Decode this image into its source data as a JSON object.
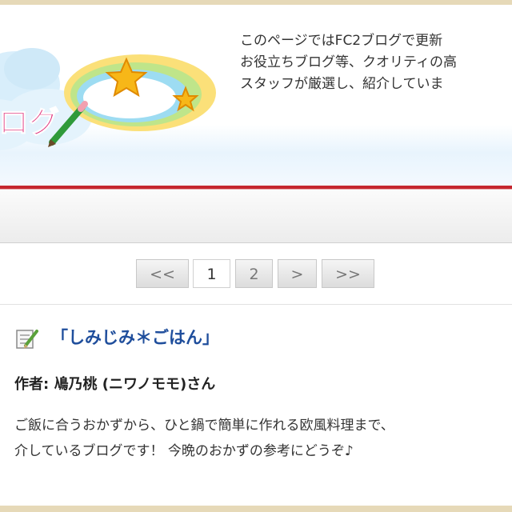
{
  "header": {
    "logo_fragment": "ログ",
    "intro_lines": [
      "このページではFC2ブログで更新",
      "お役立ちブログ等、クオリティの高",
      "スタッフが厳選し、紹介していま"
    ]
  },
  "pager": {
    "items": [
      {
        "label": "<<",
        "current": false
      },
      {
        "label": "1",
        "current": true
      },
      {
        "label": "2",
        "current": false
      },
      {
        "label": ">",
        "current": false
      },
      {
        "label": ">>",
        "current": false
      }
    ]
  },
  "post": {
    "icon": "edit-note-icon",
    "title": "「しみじみ＊ごはん」",
    "author": "作者: 鳰乃桃 (ニワノモモ)さん",
    "description_lines": [
      "ご飯に合うおかずから、ひと鍋で簡単に作れる欧風料理まで、",
      "介しているブログです！ 今晩のおかずの参考にどうぞ♪"
    ]
  },
  "colors": {
    "accent_red": "#c5262f",
    "link_blue": "#1f4e9c",
    "frame_beige": "#e6d9b8",
    "logo_pink": "#e0307a"
  }
}
